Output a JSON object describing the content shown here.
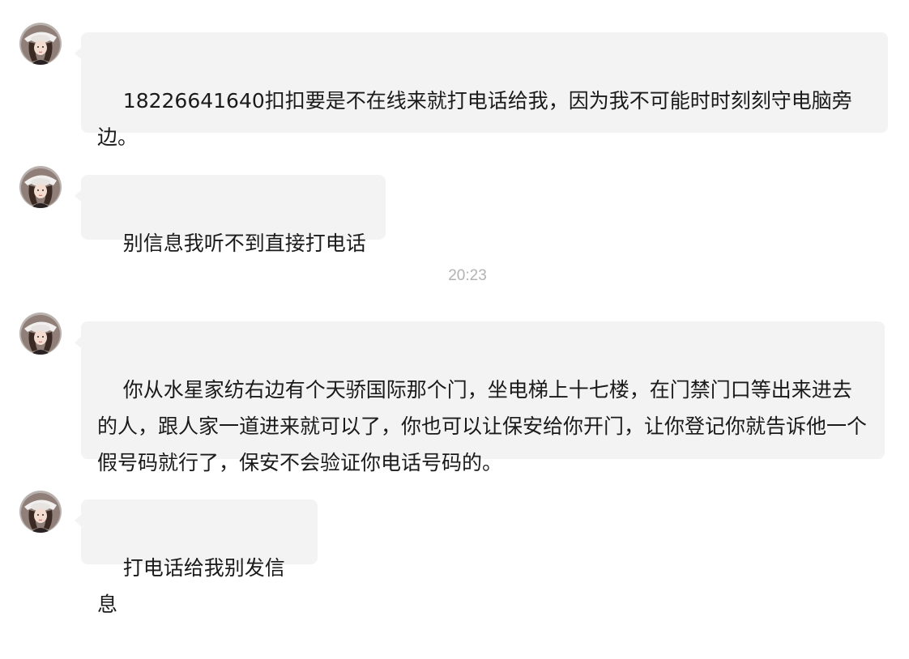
{
  "messages": [
    {
      "sender": "contact",
      "text": "18226641640扣扣要是不在线来就打电话给我，因为我不可能时时刻刻守电脑旁边。"
    },
    {
      "sender": "contact",
      "text": "别信息我听不到直接打电话"
    },
    {
      "sender": "contact",
      "text": "你从水星家纺右边有个天骄国际那个门，坐电梯上十七楼，在门禁门口等出来进去的人，跟人家一道进来就可以了，你也可以让保安给你开门，让你登记你就告诉他一个假号码就行了，保安不会验证你电话号码的。"
    },
    {
      "sender": "contact",
      "text": "打电话给我别发信息"
    }
  ],
  "timestamp": "20:23",
  "colors": {
    "bubble": "#f3f3f3",
    "timestamp": "#b3b3b3",
    "background": "#ffffff"
  },
  "icons": {
    "avatar": "contact-avatar-icon"
  }
}
